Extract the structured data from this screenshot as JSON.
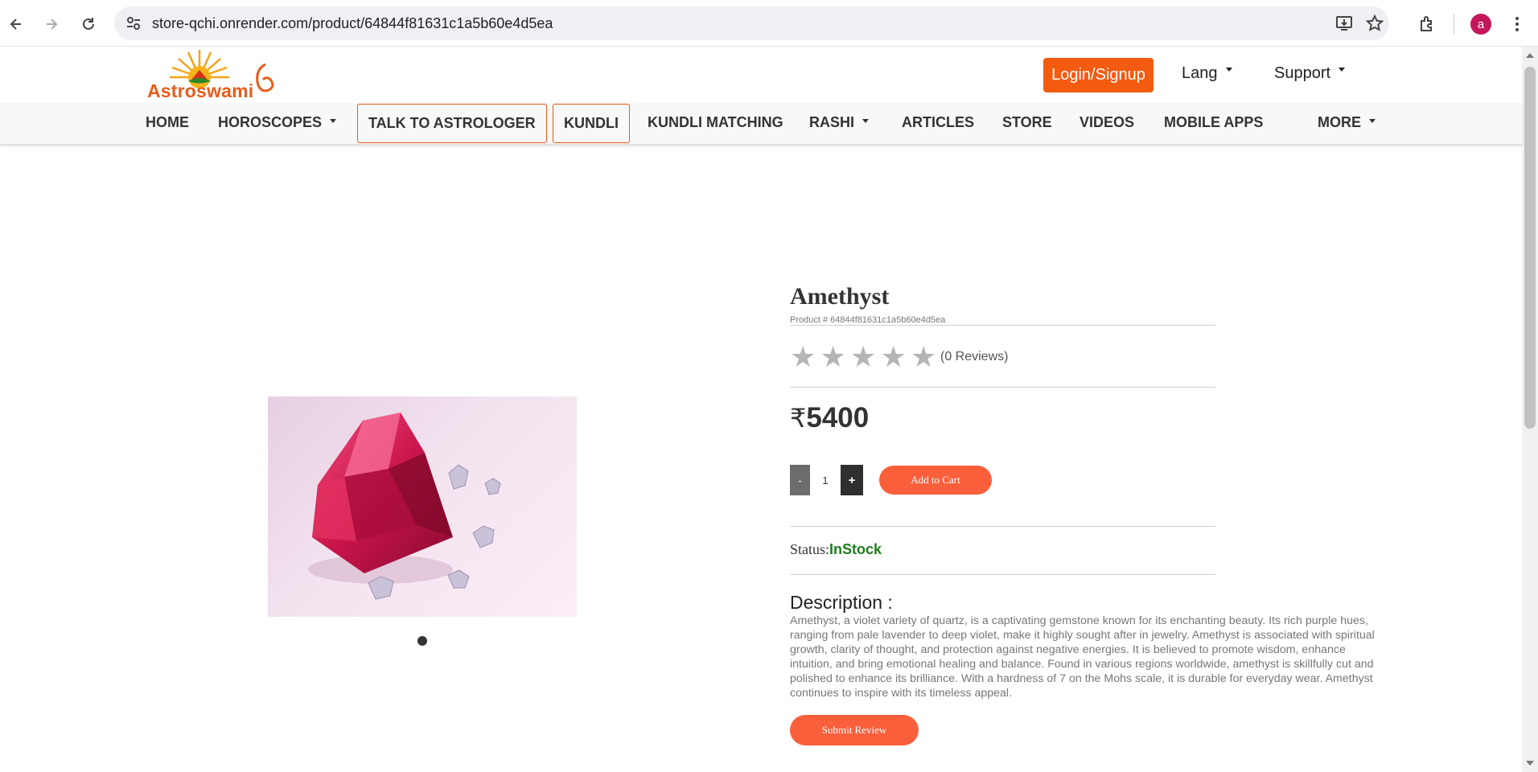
{
  "browser": {
    "url": "store-qchi.onrender.com/product/64844f81631c1a5b60e4d5ea",
    "profile_initial": "a"
  },
  "header": {
    "logo_text": "Astroswami",
    "login_label": "Login/Signup",
    "lang_label": "Lang",
    "support_label": "Support"
  },
  "nav": {
    "home": "HOME",
    "horoscopes": "HOROSCOPES",
    "talk": "TALK TO ASTROLOGER",
    "kundli": "KUNDLI",
    "kundli_matching": "KUNDLI MATCHING",
    "rashi": "RASHI",
    "articles": "ARTICLES",
    "store": "STORE",
    "videos": "VIDEOS",
    "mobile_apps": "MOBILE APPS",
    "more": "MORE"
  },
  "product": {
    "name": "Amethyst",
    "id_text": "Product # 64844f81631c1a5b60e4d5ea",
    "rating": 0,
    "max_rating": 5,
    "reviews_text": "(0 Reviews)",
    "currency": "₹",
    "price": "5400",
    "qty_minus": "-",
    "quantity": "1",
    "qty_plus": "+",
    "add_to_cart": "Add to Cart",
    "status_label": "Status:",
    "status_value": "InStock",
    "description_heading": "Description :",
    "description": "Amethyst, a violet variety of quartz, is a captivating gemstone known for its enchanting beauty. Its rich purple hues, ranging from pale lavender to deep violet, make it highly sought after in jewelry. Amethyst is associated with spiritual growth, clarity of thought, and protection against negative energies. It is believed to promote wisdom, enhance intuition, and bring emotional healing and balance. Found in various regions worldwide, amethyst is skillfully cut and polished to enhance its brilliance. With a hardness of 7 on the Mohs scale, it is durable for everyday wear. Amethyst continues to inspire with its timeless appeal.",
    "submit_review": "Submit Review"
  },
  "colors": {
    "brand_orange": "#f35b10",
    "button_coral": "#fa5f3c",
    "in_stock_green": "#1e7e1e"
  }
}
